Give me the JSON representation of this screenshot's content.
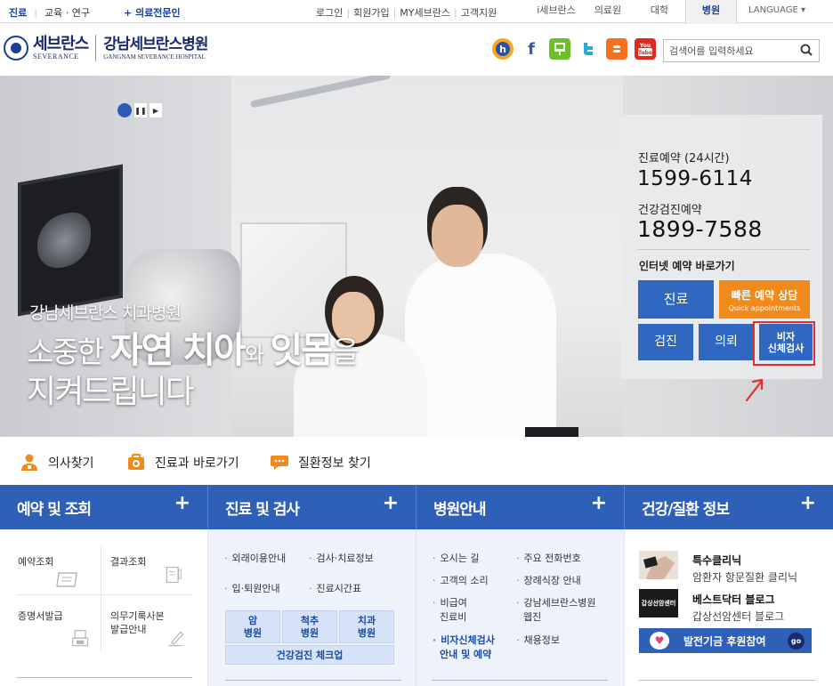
{
  "topbar": {
    "left_links": [
      "진료",
      "교육 · 연구"
    ],
    "medical_pro": "+ 의료전문인",
    "center_links": [
      "로그인",
      "회원가입",
      "MY세브란스",
      "고객지원"
    ],
    "tabs": [
      "i세브란스",
      "의료원",
      "대학",
      "병원"
    ],
    "active_tab": "병원",
    "language": "LANGUAGE ▾"
  },
  "header": {
    "logo_ko": "세브란스",
    "logo_en": "SEVERANCE",
    "hospital_ko": "강남세브란스병원",
    "hospital_en": "GANGNAM SEVERANCE HOSPITAL",
    "social_icons": [
      "blog-h-icon",
      "facebook-icon",
      "kakao-story-icon",
      "twitter-icon",
      "blogger-icon",
      "youtube-icon"
    ],
    "search_placeholder": "검색어를 입력하세요"
  },
  "hero": {
    "caption_small": "강남세브란스 치과병원",
    "caption_line1_a": "소중한",
    "caption_line1_b": "자연 치아",
    "caption_line1_c": "와",
    "caption_line1_d": "잇몸",
    "caption_line1_e": "을",
    "caption_line2": "지켜드립니다"
  },
  "panel": {
    "reservation_label": "진료예약 (24시간)",
    "reservation_number": "1599-6114",
    "checkup_label": "건강검진예약",
    "checkup_number": "1899-7588",
    "online_label": "인터넷 예약 바로가기",
    "btn_treatment": "진료",
    "btn_quick_1": "빠른 예약 상담",
    "btn_quick_2": "Quick appointments",
    "btn_checkup": "검진",
    "btn_referral": "의뢰",
    "btn_visa_1": "비자",
    "btn_visa_2": "신체검사"
  },
  "quick_links": [
    "의사찾기",
    "진료과 바로가기",
    "질환정보 찾기"
  ],
  "sections": [
    {
      "title": "예약 및 조회",
      "plus": "+"
    },
    {
      "title": "진료 및 검사",
      "plus": "+"
    },
    {
      "title": "병원안내",
      "plus": "+"
    },
    {
      "title": "건강/질환 정보",
      "plus": "+"
    }
  ],
  "col1": {
    "reservation_check": "예약조회",
    "result_check": "결과조회",
    "certificate": "증명서발급",
    "records_1": "의무기록사본",
    "records_2": "발급안내"
  },
  "col2": {
    "items": [
      "외래이용안내",
      "검사·치료정보",
      "입·퇴원안내",
      "진료시간표"
    ],
    "grid": [
      {
        "a": "암",
        "b": "병원"
      },
      {
        "a": "척추",
        "b": "병원"
      },
      {
        "a": "치과",
        "b": "병원"
      }
    ],
    "checkup": "건강검진 체크업"
  },
  "col3": {
    "items": [
      "오시는 길",
      "주요 전화번호",
      "고객의 소리",
      "장례식장 안내",
      "비급여",
      "진료비",
      "강남세브란스병원",
      "웹진",
      "비자신체검사",
      "안내 및 예약",
      "채용정보"
    ]
  },
  "col4": {
    "clinic_title": "특수클리닉",
    "clinic_sub": "암환자 항문질환 클리닉",
    "blog_title": "베스트닥터 블로그",
    "blog_sub": "갑상선암센터 블로그",
    "thumb_text": "갑상선암센터",
    "donate": "발전기금 후원참여",
    "go": "go"
  },
  "colors": {
    "brand_blue": "#2f60b7",
    "navy": "#1b2a6b",
    "orange": "#f08a1c",
    "annotation_red": "#e52d2d"
  }
}
